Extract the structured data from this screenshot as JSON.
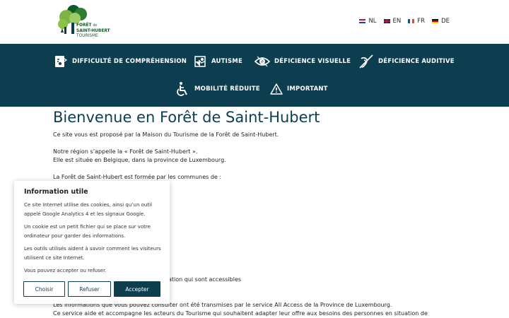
{
  "header": {
    "logo": {
      "line1": "FORÊT",
      "line1_small": "de",
      "line2": "SAINT-HUBERT",
      "line3": "TOURISME"
    },
    "languages": [
      {
        "code": "NL",
        "flag": "nl-flag-icon"
      },
      {
        "code": "EN",
        "flag": "uk-flag-icon"
      },
      {
        "code": "FR",
        "flag": "fr-flag-icon"
      },
      {
        "code": "DE",
        "flag": "de-flag-icon"
      }
    ]
  },
  "nav": {
    "items": [
      {
        "label": "DIFFICULTÉ DE COMPRÉHENSION",
        "icon": "comprehension-icon"
      },
      {
        "label": "AUTISME",
        "icon": "autism-icon"
      },
      {
        "label": "DÉFICIENCE VISUELLE",
        "icon": "visual-impairment-icon"
      },
      {
        "label": "DÉFICIENCE AUDITIVE",
        "icon": "hearing-impairment-icon"
      },
      {
        "label": "MOBILITÉ RÉDUITE",
        "icon": "wheelchair-icon"
      },
      {
        "label": "IMPORTANT",
        "icon": "warning-icon"
      }
    ],
    "background": "#0d3e50"
  },
  "main": {
    "title": "Bienvenue en Forêt de Saint-Hubert",
    "p1": "Ce site vous est proposé par la Maison du Tourisme de la Forêt de Saint-Hubert.",
    "p2a": "Notre région s’appelle la « Forêt de Saint-Hubert ».",
    "p2b": "Elle est située en Belgique, dans la province de Luxembourg.",
    "p3": "La Forêt de Saint-Hubert est formée par les communes de :",
    "p4_partial": "ation qui sont accessibles",
    "p5": "Les informations que vous pouvez consulter ont été transmises par le service All Access de la Province de Luxembourg.",
    "p6": "Ce service aide et accompagne les acteurs du Tourisme qui souhaitent adapter leur offre aux besoins des personnes en situation de"
  },
  "cookie": {
    "title": "Information utile",
    "p1": "Ce site Internet utilise des cookies, ainsi qu’un outil appelé Google Analytics 4 et les signaux Google.",
    "p2": "Un cookie est un petit fichier qui se place sur votre ordinateur pour garder des informations.",
    "p3": "Les outils utilisés aident à savoir comment les visiteurs utilisent ce site Internet.",
    "p4": "Vous pouvez accepter ou refuser.",
    "btn_choose": "Choisir",
    "btn_refuse": "Refuser",
    "btn_accept": "Accepter"
  }
}
